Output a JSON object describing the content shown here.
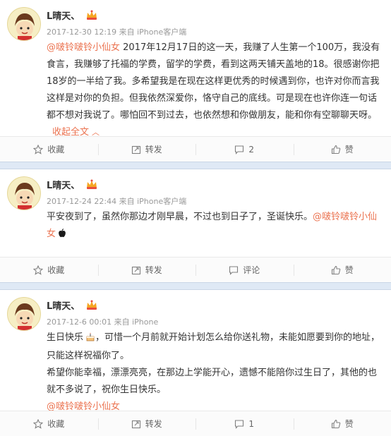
{
  "colors": {
    "accent": "#eb7350",
    "meta": "#999999",
    "separator": "#dfe9f5"
  },
  "posts": [
    {
      "user": "L晴天、",
      "meta": "2017-12-30 12:19 来自 iPhone客户端",
      "content": {
        "mention": "@啵铃啵铃小仙女",
        "text": " 2017年12月17日的这一天，我赚了人生第一个100万，我没有食言，我赚够了托福的学费，留学的学费，看到这两天铺天盖地的18。很感谢你把18岁的一半给了我。多希望我是在现在这样更优秀的时候遇到你，也许对你而言我这样是对你的负担。但我依然深爱你，恪守自己的底线。可是现在也许你连一句话都不想对我说了。哪怕回不到过去，也依然想和你做朋友，能和你有空聊聊天呀。",
        "expand": "收起全文",
        "expand_icon": "caret-up-icon"
      },
      "actions": {
        "favorite": "收藏",
        "repost": "转发",
        "comment": "2",
        "like": "赞"
      }
    },
    {
      "user": "L晴天、",
      "meta": "2017-12-24 22:44 来自 iPhone客户端",
      "content": {
        "text": "平安夜到了，虽然你那边才刚早晨，不过也到日子了，圣诞快乐。",
        "mention": "@啵铃啵铃小仙女",
        "tail_icon": "apple-icon"
      },
      "actions": {
        "favorite": "收藏",
        "repost": "转发",
        "comment": "评论",
        "like": "赞"
      }
    },
    {
      "user": "L晴天、",
      "meta": "2017-12-6 00:01 来自 iPhone",
      "content": {
        "line1_prefix": "生日快乐",
        "line1_icon": "cake-icon",
        "line1_text": "，可惜一个月前就开始计划怎么给你送礼物，未能如愿要到你的地址，只能这样祝福你了。",
        "line2": "希望你能幸福，漂漂亮亮，在那边上学能开心，遗憾不能陪你过生日了，其他的也就不多说了，祝你生日快乐。",
        "mention": "@啵铃啵铃小仙女"
      },
      "actions": {
        "favorite": "收藏",
        "repost": "转发",
        "comment": "1",
        "like": "赞"
      }
    }
  ]
}
